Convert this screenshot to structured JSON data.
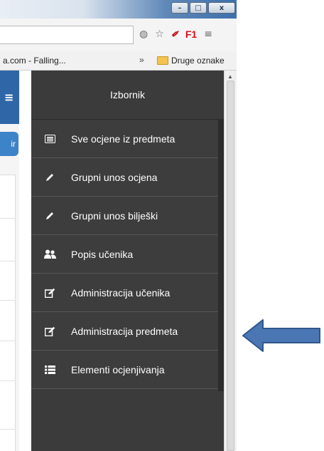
{
  "window": {
    "controls": {
      "minimize": "–",
      "maximize": "□",
      "close": "x"
    }
  },
  "toolbar": {
    "f1_label": "F1",
    "ferrari_glyph": "✐",
    "menu_glyph": "≡",
    "shield_glyph": "◍",
    "star_glyph": "☆"
  },
  "bookmarks": {
    "left_item": "a.com - Falling...",
    "overflow": "»",
    "folder_label": "Druge oznake"
  },
  "page": {
    "partial_button_text": "ir",
    "hamburger_glyph": "≡"
  },
  "menu": {
    "title": "Izbornik",
    "items": [
      {
        "label": "Sve ocjene iz predmeta",
        "icon": "list-alt-icon"
      },
      {
        "label": "Grupni unos ocjena",
        "icon": "pencil-icon"
      },
      {
        "label": "Grupni unos bilješki",
        "icon": "pencil-icon"
      },
      {
        "label": "Popis učenika",
        "icon": "users-icon"
      },
      {
        "label": "Administracija učenika",
        "icon": "edit-icon"
      },
      {
        "label": "Administracija predmeta",
        "icon": "edit-icon"
      },
      {
        "label": "Elementi ocjenjivanja",
        "icon": "list-icon"
      }
    ]
  },
  "colors": {
    "menu_bg": "#3d3d3d",
    "header_blue": "#2f66a7",
    "arrow_blue": "#4a77b4"
  }
}
